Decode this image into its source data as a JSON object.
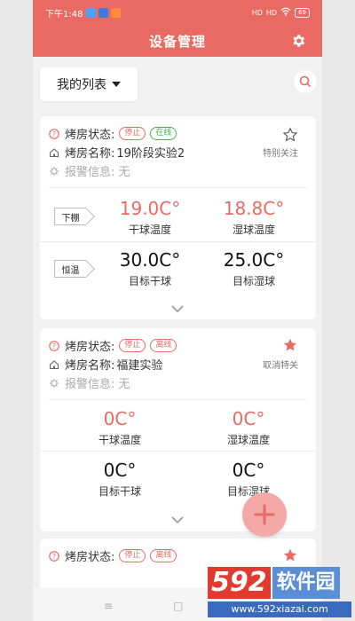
{
  "status_bar": {
    "time": "下午1:48",
    "signal1": "HD",
    "signal2": "HD",
    "battery": "69"
  },
  "header": {
    "title": "设备管理"
  },
  "toolbar": {
    "list_label": "我的列表"
  },
  "cards": [
    {
      "status_label": "烤房状态:",
      "badge1": "停止",
      "badge2": "在线",
      "name_label": "烤房名称:",
      "name_value": "19阶段实验2",
      "alarm": "报警信息: 无",
      "fav_label": "特别关注",
      "fav_active": false,
      "section1_tag": "下棚",
      "dry_temp": "19.0C°",
      "dry_label": "干球温度",
      "wet_temp": "18.8C°",
      "wet_label": "湿球温度",
      "section2_tag": "恒温",
      "target_dry": "30.0C°",
      "target_dry_label": "目标干球",
      "target_wet": "25.0C°",
      "target_wet_label": "目标湿球"
    },
    {
      "status_label": "烤房状态:",
      "badge1": "停止",
      "badge2": "离线",
      "name_label": "烤房名称:",
      "name_value": "福建实验",
      "alarm": "报警信息: 无",
      "fav_label": "取消特关",
      "fav_active": true,
      "dry_temp": "0C°",
      "dry_label": "干球温度",
      "wet_temp": "0C°",
      "wet_label": "湿球温度",
      "target_dry": "0C°",
      "target_dry_label": "目标干球",
      "target_wet": "0C°",
      "target_wet_label": "目标湿球"
    },
    {
      "status_label": "烤房状态:",
      "badge1": "停止",
      "badge2": "离线"
    }
  ],
  "watermark": {
    "num": "592",
    "cn": "软件园",
    "url": "www.592xiazai.com"
  },
  "colors": {
    "accent": "#e96a63",
    "fab": "#f3a9a5",
    "online": "#4caf50"
  }
}
